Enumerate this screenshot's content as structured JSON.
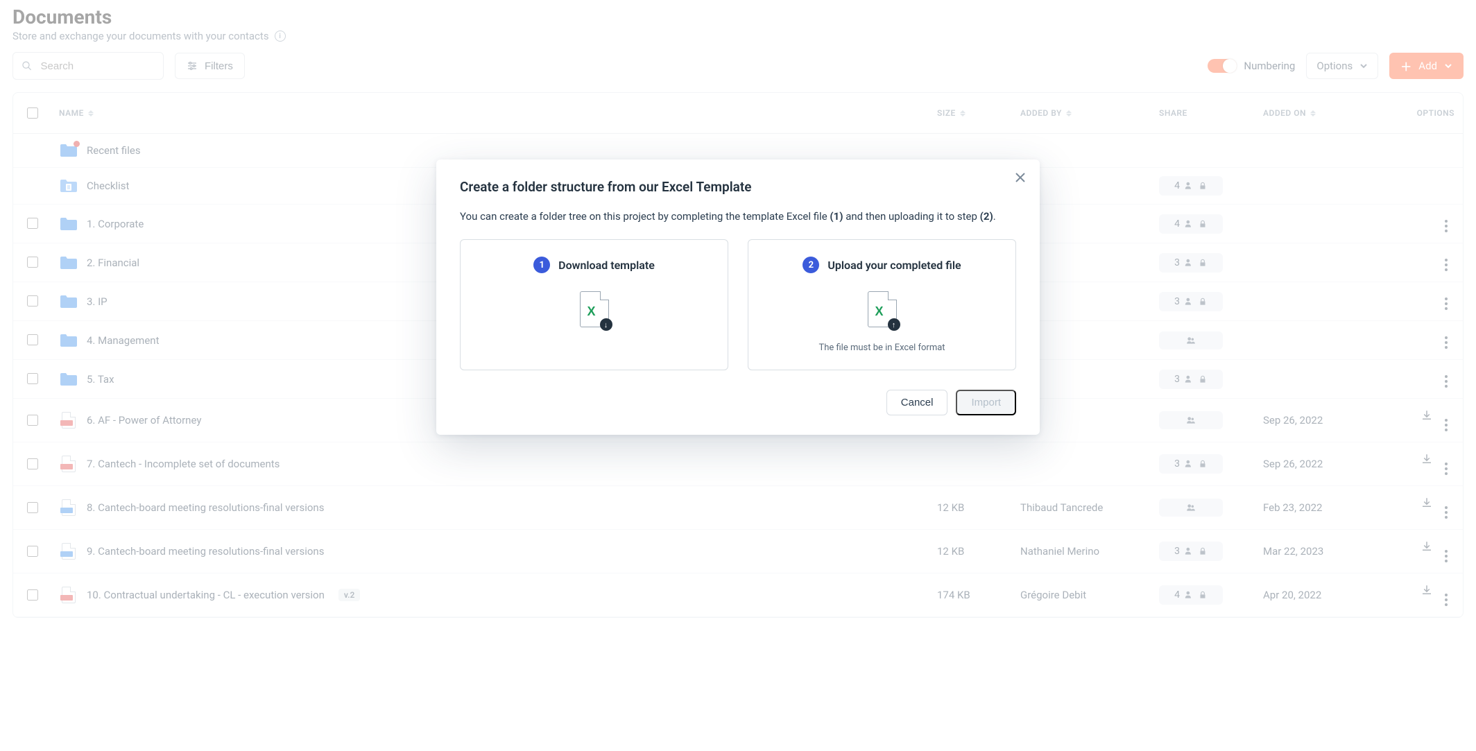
{
  "page": {
    "title": "Documents",
    "subtitle": "Store and exchange your documents with your contacts"
  },
  "toolbar": {
    "search_placeholder": "Search",
    "filters_label": "Filters",
    "toggle_label": "Numbering",
    "options_label": "Options",
    "add_label": "Add"
  },
  "columns": {
    "name": "NAME",
    "size": "SIZE",
    "added_by": "ADDED BY",
    "share": "SHARE",
    "added_on": "ADDED ON",
    "options": "OPTIONS"
  },
  "rows": [
    {
      "icon": "folder-recent",
      "name": "Recent files",
      "size": "",
      "added_by": "",
      "share_type": "none",
      "share_count": "",
      "added_on": "",
      "download": false,
      "menu": false
    },
    {
      "icon": "folder-clip",
      "name": "Checklist",
      "size": "",
      "added_by": "",
      "share_type": "lock",
      "share_count": "4",
      "added_on": "",
      "download": false,
      "menu": false
    },
    {
      "icon": "folder",
      "name": "1. Corporate",
      "size": "",
      "added_by": "",
      "share_type": "lock",
      "share_count": "4",
      "added_on": "",
      "download": false,
      "menu": true
    },
    {
      "icon": "folder",
      "name": "2. Financial",
      "size": "",
      "added_by": "",
      "share_type": "lock",
      "share_count": "3",
      "added_on": "",
      "download": false,
      "menu": true
    },
    {
      "icon": "folder",
      "name": "3. IP",
      "size": "",
      "added_by": "",
      "share_type": "lock",
      "share_count": "3",
      "added_on": "",
      "download": false,
      "menu": true
    },
    {
      "icon": "folder",
      "name": "4. Management",
      "size": "",
      "added_by": "",
      "share_type": "group",
      "share_count": "",
      "added_on": "",
      "download": false,
      "menu": true
    },
    {
      "icon": "folder",
      "name": "5. Tax",
      "size": "",
      "added_by": "",
      "share_type": "lock",
      "share_count": "3",
      "added_on": "",
      "download": false,
      "menu": true
    },
    {
      "icon": "pdf",
      "name": "6. AF - Power of Attorney",
      "size": "",
      "added_by": "",
      "share_type": "group",
      "share_count": "",
      "added_on": "Sep 26, 2022",
      "download": true,
      "menu": true
    },
    {
      "icon": "pdf",
      "name": "7. Cantech - Incomplete set of documents",
      "size": "",
      "added_by": "",
      "share_type": "lock",
      "share_count": "3",
      "added_on": "Sep 26, 2022",
      "download": true,
      "menu": true
    },
    {
      "icon": "doc",
      "name": "8. Cantech-board meeting resolutions-final versions",
      "size": "12 KB",
      "added_by": "Thibaud Tancrede",
      "share_type": "group",
      "share_count": "",
      "added_on": "Feb 23, 2022",
      "download": true,
      "menu": true
    },
    {
      "icon": "doc",
      "name": "9. Cantech-board meeting resolutions-final versions",
      "size": "12 KB",
      "added_by": "Nathaniel Merino",
      "share_type": "lock",
      "share_count": "3",
      "added_on": "Mar 22, 2023",
      "download": true,
      "menu": true
    },
    {
      "icon": "pdf",
      "name": "10. Contractual undertaking - CL - execution version",
      "version": "v.2",
      "size": "174 KB",
      "added_by": "Grégoire Debit",
      "share_type": "lock",
      "share_count": "4",
      "added_on": "Apr 20, 2022",
      "download": true,
      "menu": true
    }
  ],
  "modal": {
    "title": "Create a folder structure from our Excel Template",
    "desc_prefix": "You can create a folder tree on this project by completing the template Excel file ",
    "desc_step1": "(1)",
    "desc_mid": " and then uploading it to step ",
    "desc_step2": "(2)",
    "desc_suffix": ".",
    "step1_num": "1",
    "step1_title": "Download template",
    "step2_num": "2",
    "step2_title": "Upload your completed file",
    "hint": "The file must be in Excel format",
    "cancel": "Cancel",
    "import": "Import"
  }
}
